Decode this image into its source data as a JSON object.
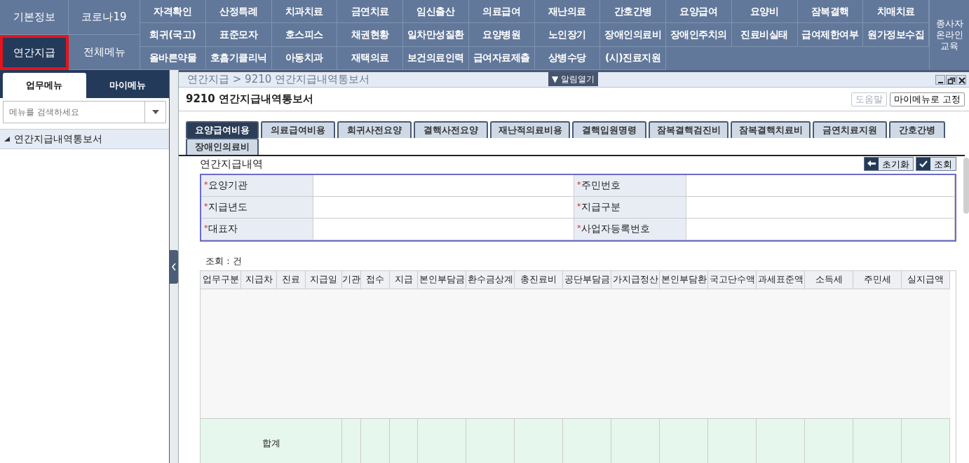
{
  "top_menu": {
    "left_items": [
      {
        "label": "기본정보",
        "selected": false
      },
      {
        "label": "코로나19",
        "selected": false
      },
      {
        "label": "연간지급",
        "selected": true
      },
      {
        "label": "전체메뉴",
        "selected": false
      }
    ],
    "grid_items": [
      "자격확인",
      "산정특례",
      "치과치료",
      "금연치료",
      "임신출산",
      "의료급여",
      "재난의료",
      "간호간병",
      "요양급여",
      "요양비",
      "잠복결핵",
      "치매치료",
      "희귀(국고)",
      "표준모자",
      "호스피스",
      "채권현황",
      "일차만성질환",
      "요양병원",
      "노인장기",
      "장애인의료비",
      "장애인주치의",
      "진료비실태",
      "급여제한여부",
      "원가정보수집",
      "올바른약물",
      "호흡기클리닉",
      "아동치과",
      "재택의료",
      "보건의료인력",
      "급여자료제출",
      "상병수당",
      "(시)진료지원"
    ],
    "side_item": "종사자 온라인 교육"
  },
  "sidebar": {
    "tabs": [
      {
        "label": "업무메뉴",
        "selected": true
      },
      {
        "label": "마이메뉴",
        "selected": false
      }
    ],
    "search": {
      "placeholder": "메뉴를 검색하세요"
    },
    "tree": [
      {
        "label": "연간지급내역통보서",
        "expanded": true
      }
    ]
  },
  "breadcrumb": "연간지급 > 9210 연간지급내역통보서",
  "alert_button": "▼ 알림열기",
  "page_title": "9210 연간지급내역통보서",
  "header_buttons": [
    {
      "label": "도움말",
      "disabled": true
    },
    {
      "label": "마이메뉴로 고정",
      "disabled": false
    }
  ],
  "tabs": [
    {
      "label": "요양급여비용",
      "selected": true
    },
    {
      "label": "의료급여비용",
      "selected": false
    },
    {
      "label": "희귀사전요양",
      "selected": false
    },
    {
      "label": "결핵사전요양",
      "selected": false
    },
    {
      "label": "재난적의료비용",
      "selected": false
    },
    {
      "label": "결핵입원명령",
      "selected": false
    },
    {
      "label": "잠복결핵검진비",
      "selected": false
    },
    {
      "label": "잠복결핵치료비",
      "selected": false
    },
    {
      "label": "금연치료지원",
      "selected": false
    },
    {
      "label": "간호간병",
      "selected": false
    },
    {
      "label": "장애인의료비",
      "selected": false
    }
  ],
  "section_title": "연간지급내역",
  "action_buttons": [
    {
      "label": "초기화",
      "kind": "reset"
    },
    {
      "label": "조회",
      "kind": "search"
    }
  ],
  "form_fields": [
    {
      "label": "요양기관",
      "required": true
    },
    {
      "label": "주민번호",
      "required": true
    },
    {
      "label": "지급년도",
      "required": true
    },
    {
      "label": "지급구분",
      "required": true
    },
    {
      "label": "대표자",
      "required": true
    },
    {
      "label": "사업자등록번호",
      "required": true
    }
  ],
  "required_mark": "*",
  "result_count": "조회 : 건",
  "table": {
    "columns": [
      "업무구분",
      "지급차",
      "진료",
      "지급일",
      "기관",
      "접수",
      "지급",
      "본인부담금",
      "환수금상계",
      "총진료비",
      "공단부담금",
      "가지급정산",
      "본인부담환",
      "국고단수액",
      "과세표준액",
      "소득세",
      "주민세",
      "실지급액"
    ],
    "total_label": "합계"
  }
}
